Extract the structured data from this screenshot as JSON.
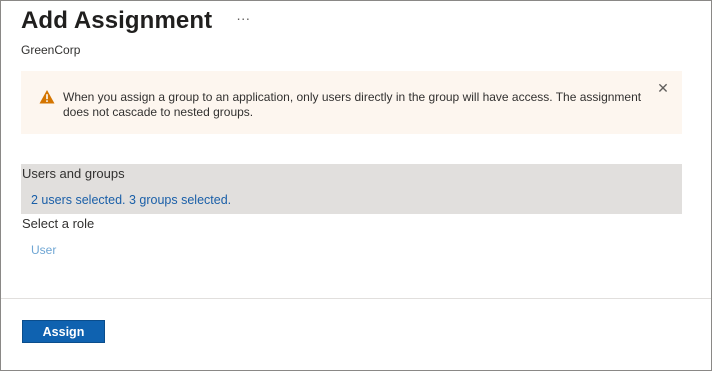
{
  "header": {
    "title": "Add Assignment",
    "more_label": "···",
    "subtitle": "GreenCorp"
  },
  "banner": {
    "icon": "warning-icon",
    "message": "When you assign a group to an application, only users directly in the group will have access. The assignment does not cascade to nested groups.",
    "close_icon": "close-icon",
    "close_label": "✕",
    "background": "#fdf6ef",
    "icon_color": "#d47500"
  },
  "users_groups": {
    "label": "Users and groups",
    "selection": "2 users selected. 3 groups selected."
  },
  "role": {
    "label": "Select a role",
    "value": "User"
  },
  "footer": {
    "assign_label": "Assign",
    "accent": "#0f62b0"
  }
}
